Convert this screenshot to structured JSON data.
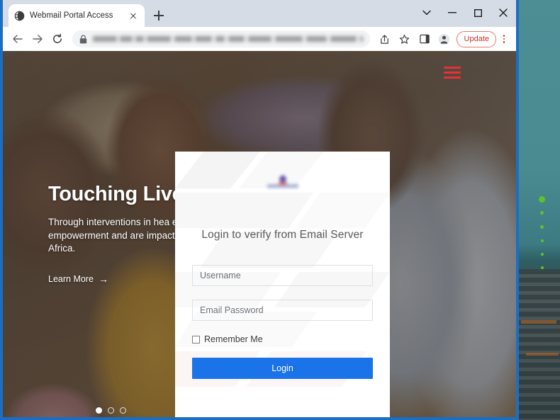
{
  "browser": {
    "tab": {
      "title": "Webmail Portal Access",
      "favicon_name": "globe-icon",
      "close_name": "tab-close-icon"
    },
    "new_tab_label": "+",
    "window_controls": [
      {
        "name": "tab-search-chevron",
        "glyph": "⌄"
      },
      {
        "name": "minimize",
        "glyph": "–"
      },
      {
        "name": "maximize",
        "glyph": "□"
      },
      {
        "name": "close",
        "glyph": "✕"
      }
    ],
    "toolbar": {
      "back_glyph": "←",
      "forward_glyph": "→",
      "reload_glyph": "⟳",
      "lock_name": "lock-icon",
      "url_value": "",
      "url_state": "blurred",
      "share_name": "share-icon",
      "bookmark_name": "star-icon",
      "side_panel_name": "side-panel-icon",
      "profile_name": "profile-avatar-icon",
      "update_label": "Update",
      "update_color": "#c5372c",
      "menu_name": "three-dot-menu-icon"
    }
  },
  "page": {
    "hamburger_color": "#e53232",
    "hero": {
      "heading": "Touching Lives",
      "body": "Through interventions in hea economic empowerment and are impacting the lives of mil Africa.",
      "learn_more": "Learn More",
      "learn_more_arrow": "→"
    },
    "carousel": {
      "dots": 3,
      "active_index": 0
    },
    "scroll_chevron_name": "chevron-down-icon"
  },
  "login_modal": {
    "logo_name": "brand-logo",
    "heading": "Login to verify from Email Server",
    "username": {
      "placeholder": "Username",
      "value": ""
    },
    "password": {
      "placeholder": "Email Password",
      "value": ""
    },
    "remember_label": "Remember Me",
    "remember_checked": false,
    "login_label": "Login",
    "login_color": "#1a73e8"
  },
  "theme": {
    "window_frame": "#1a6fc4",
    "tabstrip_bg": "#d6dce6",
    "omnibox_bg": "#f1f3f4"
  }
}
